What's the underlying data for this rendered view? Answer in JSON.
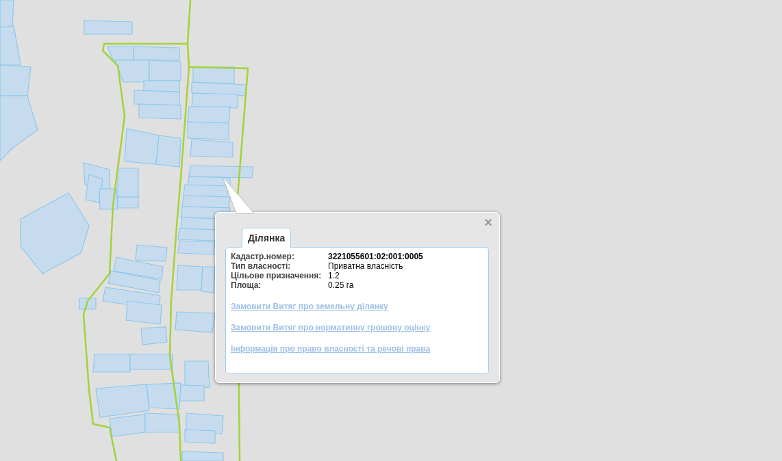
{
  "popup": {
    "close": "×",
    "tabs": [
      {
        "label": "Ділянка",
        "selected": true
      }
    ],
    "fields": [
      {
        "label": "Кадастр.номер:",
        "value": "3221055601:02:001:0005",
        "kind": "bold"
      },
      {
        "label": "Тип власності:",
        "value": "Приватна власність",
        "kind": "plain"
      },
      {
        "label": "Цільове призначення:",
        "value": "1.2",
        "kind": "plain"
      },
      {
        "label": "Площа:",
        "value": "0.25 га",
        "kind": "plain"
      }
    ],
    "links": [
      "Замовити Витяг про земельну ділянку",
      "Замовити Витяг про нормативну грошову оцінку",
      "Інформація про право власності та речові права"
    ]
  }
}
